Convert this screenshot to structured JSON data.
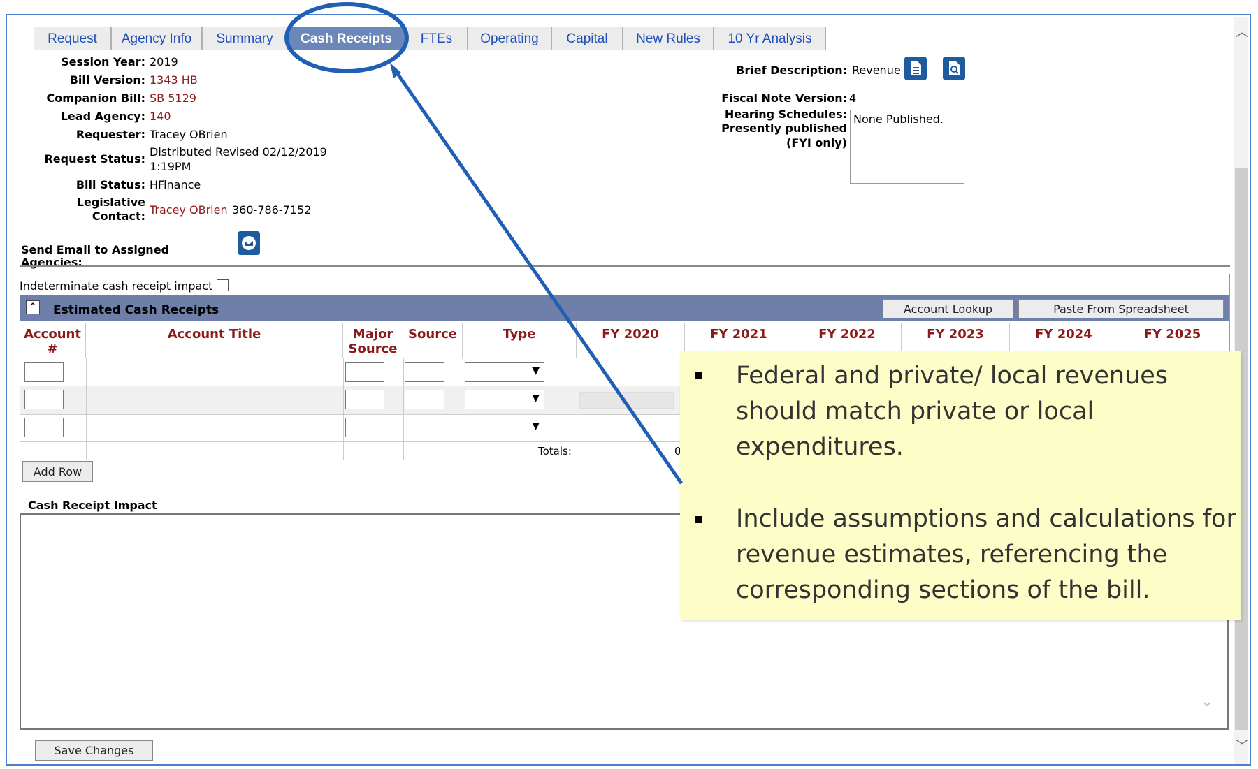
{
  "tabs": [
    "Request",
    "Agency Info",
    "Summary",
    "Cash Receipts",
    "FTEs",
    "Operating",
    "Capital",
    "New Rules",
    "10 Yr Analysis"
  ],
  "active_tab": "Cash Receipts",
  "info": {
    "session_year_label": "Session Year:",
    "session_year": "2019",
    "bill_version_label": "Bill Version:",
    "bill_version": "1343 HB",
    "companion_bill_label": "Companion Bill:",
    "companion_bill": "SB 5129",
    "lead_agency_label": "Lead Agency:",
    "lead_agency": "140",
    "requester_label": "Requester:",
    "requester": "Tracey OBrien",
    "request_status_label": "Request Status:",
    "request_status_line1": "Distributed Revised 02/12/2019",
    "request_status_line2": "1:19PM",
    "bill_status_label": "Bill Status:",
    "bill_status": "HFinance",
    "legislative_label1": "Legislative",
    "legislative_label2": "Contact:",
    "legislative_name": "Tracey OBrien",
    "legislative_phone": "360-786-7152",
    "send_email_label": "Send Email to Assigned Agencies:"
  },
  "right_info": {
    "brief_label": "Brief Description:",
    "brief_value": "Revenue",
    "fiscal_note_label": "Fiscal Note Version:",
    "fiscal_note_value": "4",
    "hearing_label1": "Hearing Schedules:",
    "hearing_label2": "Presently published",
    "hearing_label3": "(FYI only)",
    "hearing_value": "None Published."
  },
  "indeterminate_label": "Indeterminate cash receipt impact",
  "grid": {
    "title": "Estimated Cash Receipts",
    "account_lookup": "Account Lookup",
    "paste_label": "Paste From Spreadsheet",
    "headers": {
      "account1": "Account",
      "account2": "#",
      "title": "Account Title",
      "major1": "Major",
      "major2": "Source",
      "source": "Source",
      "type": "Type",
      "fy": [
        "FY 2020",
        "FY 2021",
        "FY 2022",
        "FY 2023",
        "FY 2024",
        "FY 2025"
      ]
    },
    "totals_label": "Totals:",
    "totals_value_partial": "0",
    "add_row": "Add Row"
  },
  "cash_receipt_impact_label": "Cash Receipt Impact",
  "save_changes": "Save Changes",
  "callout": {
    "bullet1_l1": "Federal and private/ local revenues",
    "bullet1_l2": "should match private or local",
    "bullet1_l3": "expenditures.",
    "bullet2_l1": "Include assumptions and calculations for",
    "bullet2_l2": "revenue estimates, referencing the",
    "bullet2_l3": "corresponding sections of the bill."
  },
  "colors": {
    "accent": "#1e5a9e",
    "tab_active": "#6b86b8",
    "header_red": "#8b1a1a",
    "callout_bg": "#fdfdc8"
  },
  "icons": [
    "document-icon",
    "search-document-icon",
    "email-icon",
    "collapse-icon",
    "chevron-down-icon",
    "arrow-icon"
  ]
}
